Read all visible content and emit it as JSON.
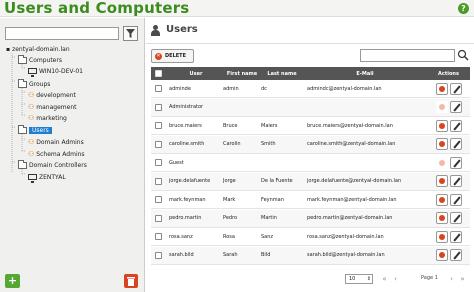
{
  "app": {
    "title": "Users and Computers",
    "help_label": "?"
  },
  "tree": {
    "root": "zentyal-domain.lan",
    "computers": "Computers",
    "computer_1": "WIN10-DEV-01",
    "groups": "Groups",
    "group_1": "development",
    "group_2": "management",
    "group_3": "marketing",
    "users": "Users",
    "users_1": "Domain Admins",
    "users_2": "Schema Admins",
    "dc": "Domain Controllers",
    "dc_1": "ZENTYAL"
  },
  "left_footer": {
    "add_label": "+"
  },
  "panel": {
    "title": "Users",
    "delete_label": "DELETE",
    "columns": [
      "User",
      "First name",
      "Last name",
      "E-Mail",
      "Actions"
    ],
    "rows": [
      {
        "user": "adminde",
        "first": "admin",
        "last": "dc",
        "email": "admindc@zentyal-domain.lan",
        "deletable": true
      },
      {
        "user": "Administrator",
        "first": "",
        "last": "",
        "email": "",
        "deletable": false
      },
      {
        "user": "bruce.maiers",
        "first": "Bruce",
        "last": "Maiers",
        "email": "bruce.maiers@zentyal-domain.lan",
        "deletable": true
      },
      {
        "user": "caroline.smith",
        "first": "Carolin",
        "last": "Smith",
        "email": "caroline.smith@zentyal-domain.lan",
        "deletable": true
      },
      {
        "user": "Guest",
        "first": "",
        "last": "",
        "email": "",
        "deletable": false
      },
      {
        "user": "jorge.delafuente",
        "first": "Jorge",
        "last": "De la Fuente",
        "email": "jorge.delafuente@zentyal-domain.lan",
        "deletable": true
      },
      {
        "user": "mark.feynman",
        "first": "Mark",
        "last": "Feynman",
        "email": "mark.feynman@zentyal-domain.lan",
        "deletable": true
      },
      {
        "user": "pedro.martin",
        "first": "Pedro",
        "last": "Martin",
        "email": "pedro.martin@zentyal-domain.lan",
        "deletable": true
      },
      {
        "user": "rosa.sanz",
        "first": "Rosa",
        "last": "Sanz",
        "email": "rosa.sanz@zentyal-domain.lan",
        "deletable": true
      },
      {
        "user": "sarah.bild",
        "first": "Sarah",
        "last": "Bild",
        "email": "sarah.bild@zentyal-domain.lan",
        "deletable": true
      }
    ],
    "page_size": "10",
    "page_label": "Page 1"
  },
  "colors": {
    "accent": "#3d8c1f",
    "selected": "#1e7fd1",
    "danger": "#d9431e",
    "header_bg": "#555555"
  }
}
